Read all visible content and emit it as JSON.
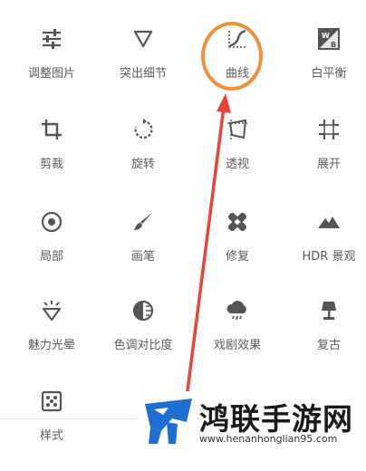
{
  "tools": [
    {
      "key": "adjust",
      "label": "调整图片"
    },
    {
      "key": "highlight",
      "label": "突出细节"
    },
    {
      "key": "curves",
      "label": "曲线"
    },
    {
      "key": "wb",
      "label": "白平衡"
    },
    {
      "key": "crop",
      "label": "剪裁"
    },
    {
      "key": "rotate",
      "label": "旋转"
    },
    {
      "key": "perspective",
      "label": "透视"
    },
    {
      "key": "expand",
      "label": "展开"
    },
    {
      "key": "local",
      "label": "局部"
    },
    {
      "key": "brush",
      "label": "画笔"
    },
    {
      "key": "healing",
      "label": "修复"
    },
    {
      "key": "hdr",
      "label": "HDR 景观"
    },
    {
      "key": "glamour",
      "label": "魅力光晕"
    },
    {
      "key": "tonal",
      "label": "色调对比度"
    },
    {
      "key": "drama",
      "label": "戏剧效果"
    },
    {
      "key": "vintage",
      "label": "复古"
    },
    {
      "key": "styles",
      "label": "样式"
    }
  ],
  "icons": {
    "wb_letters": "WB"
  },
  "colors": {
    "highlight": "#f0903c",
    "arrow": "#e8443a",
    "icon": "#555555",
    "watermark_blue": "#1f6fd0"
  },
  "watermark": {
    "title": "鸿联手游网",
    "url": "www.henanhonglian95.com"
  }
}
